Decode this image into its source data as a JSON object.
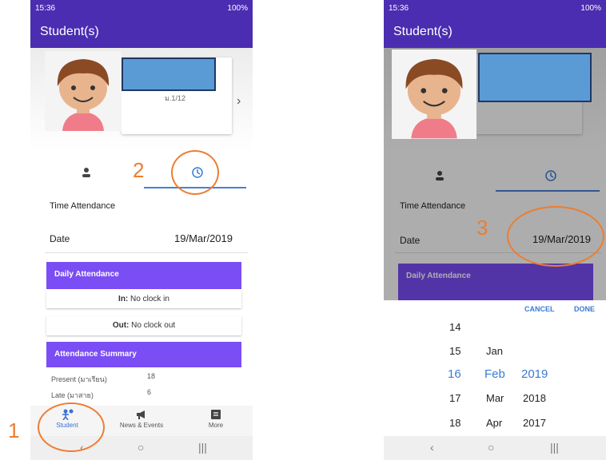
{
  "status": {
    "time": "15:36",
    "battery": "100%"
  },
  "app": {
    "title": "Student(s)"
  },
  "student": {
    "class": "ม.1/12"
  },
  "time_attendance_label": "Time Attendance",
  "date_label": "Date",
  "date_value": "19/Mar/2019",
  "daily_attendance": {
    "title": "Daily Attendance",
    "in_label": "In:",
    "in_value": "No clock in",
    "out_label": "Out:",
    "out_value": "No clock out"
  },
  "summary": {
    "title": "Attendance Summary",
    "rows": [
      {
        "label": "Present (มาเรียน)",
        "value": "18"
      },
      {
        "label": "Late (มาสาย)",
        "value": "6"
      }
    ]
  },
  "bottom_nav": [
    {
      "label": "Student",
      "icon": "student-icon",
      "active": true
    },
    {
      "label": "News & Events",
      "icon": "megaphone-icon",
      "active": false
    },
    {
      "label": "More",
      "icon": "more-icon",
      "active": false
    }
  ],
  "picker": {
    "cancel": "CANCEL",
    "done": "DONE",
    "days": [
      "14",
      "15",
      "16",
      "17",
      "18"
    ],
    "months": [
      "Jan",
      "Feb",
      "Mar",
      "Apr"
    ],
    "years": [
      "2019",
      "2018",
      "2017"
    ],
    "selected": {
      "day": "16",
      "month": "Feb",
      "year": "2019"
    }
  },
  "annotations": {
    "step1": "1",
    "step2": "2",
    "step3": "3",
    "color": "#ed7d31"
  },
  "colors": {
    "primary": "#4a2db0",
    "section": "#7b4df5",
    "accent": "#3a7bd5"
  }
}
